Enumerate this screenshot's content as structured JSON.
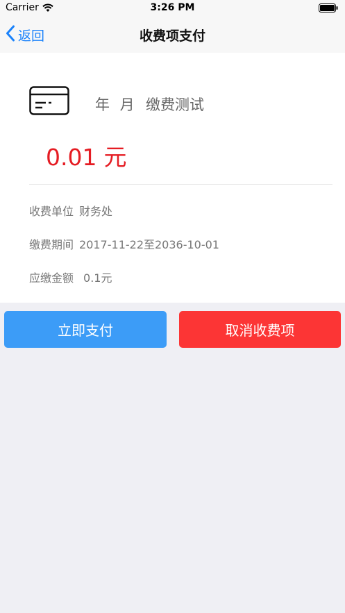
{
  "status_bar": {
    "carrier": "Carrier",
    "time": "3:26 PM"
  },
  "nav": {
    "back_label": "返回",
    "title": "收费项支付"
  },
  "card": {
    "icon": "credit-card-icon",
    "month_label": "年 月",
    "item_name": "缴费测试",
    "amount": "0.01",
    "amount_unit": "元",
    "rows": [
      {
        "label": "收费单位",
        "value": "财务处"
      },
      {
        "label": "缴费期间",
        "value": "2017-11-22至2036-10-01"
      },
      {
        "label": "应缴金额",
        "value": "0.1元"
      }
    ]
  },
  "actions": {
    "pay_label": "立即支付",
    "cancel_label": "取消收费项"
  },
  "colors": {
    "accent": "#1a82fb",
    "pay_button": "#3c9cf7",
    "cancel_button": "#fc3535",
    "amount": "#e51c23",
    "background": "#efeff4"
  }
}
